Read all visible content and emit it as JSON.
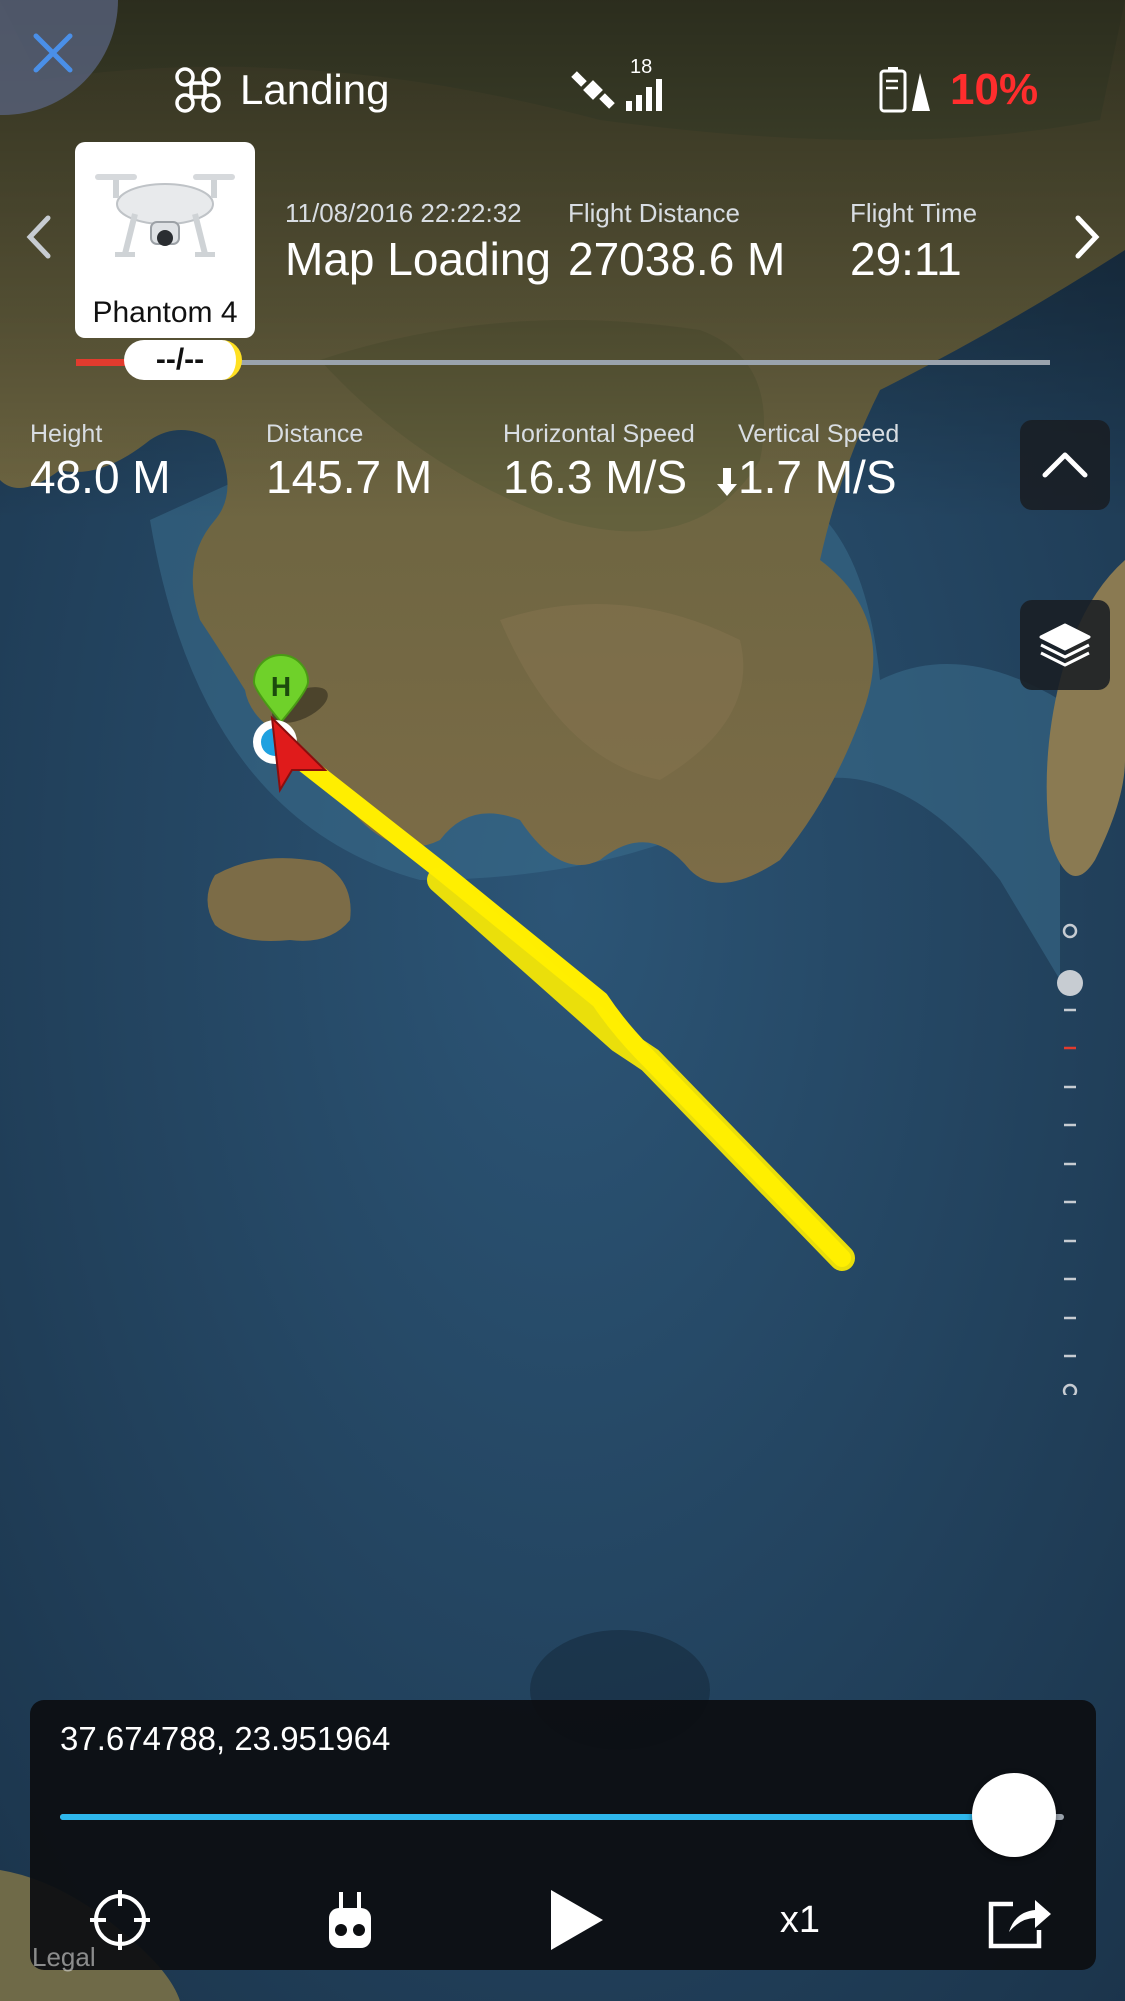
{
  "status_bar": {
    "flight_mode": "Landing",
    "satellite_count": "18",
    "battery_percent": "10%"
  },
  "flight_record": {
    "aircraft_name": "Phantom 4",
    "datetime": "11/08/2016 22:22:32",
    "location": "Map Loading",
    "flight_distance_label": "Flight Distance",
    "flight_distance_value": "27038.6 M",
    "flight_time_label": "Flight Time",
    "flight_time_value": "29:11",
    "timeline_marker": "--/--"
  },
  "telemetry": {
    "height_label": "Height",
    "height_value": "48.0 M",
    "distance_label": "Distance",
    "distance_value": "145.7 M",
    "horizontal_speed_label": "Horizontal Speed",
    "horizontal_speed_value": "16.3 M/S",
    "vertical_speed_label": "Vertical Speed",
    "vertical_speed_value": "1.7 M/S"
  },
  "playback": {
    "coordinates": "37.674788, 23.951964",
    "progress_fraction": 0.95,
    "speed": "x1"
  },
  "map": {
    "home_marker_letter": "H",
    "legal_text": "Legal"
  },
  "colors": {
    "battery_warning": "#ff2d2d",
    "flight_path": "#ffee00",
    "slider_fill": "#2eb7ec",
    "home_marker": "#6fd12a",
    "aircraft_arrow": "#e01b1b"
  },
  "icons": {
    "close": "close-icon",
    "flight_mode": "drone-icon",
    "gps": "satellite-icon",
    "signal": "signal-bars-icon",
    "battery": "battery-icon",
    "prev": "chevron-left-icon",
    "next": "chevron-right-icon",
    "collapse": "chevron-up-icon",
    "layers": "layers-icon",
    "locate": "crosshair-icon",
    "remote": "remote-controller-icon",
    "play": "play-icon",
    "share": "share-icon"
  }
}
